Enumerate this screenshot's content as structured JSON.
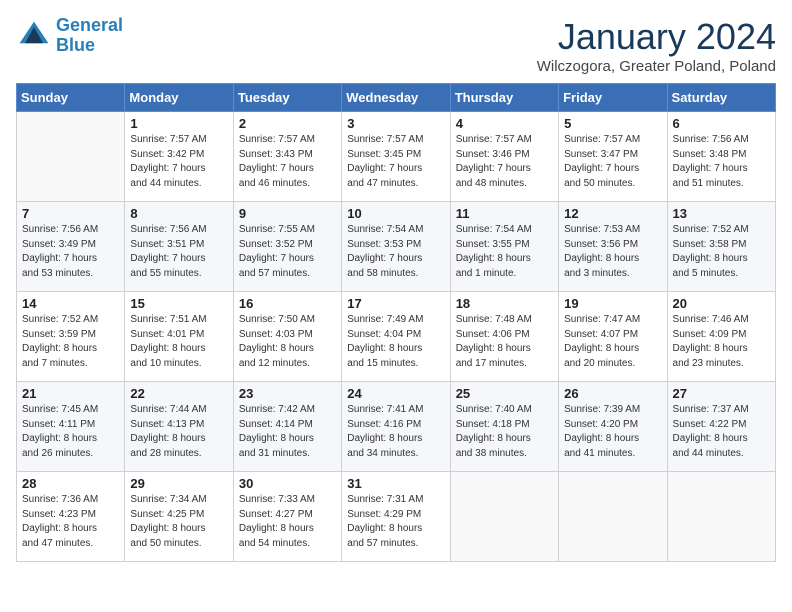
{
  "header": {
    "logo_line1": "General",
    "logo_line2": "Blue",
    "month_title": "January 2024",
    "subtitle": "Wilczogora, Greater Poland, Poland"
  },
  "days_of_week": [
    "Sunday",
    "Monday",
    "Tuesday",
    "Wednesday",
    "Thursday",
    "Friday",
    "Saturday"
  ],
  "weeks": [
    [
      {
        "day": "",
        "info": ""
      },
      {
        "day": "1",
        "info": "Sunrise: 7:57 AM\nSunset: 3:42 PM\nDaylight: 7 hours\nand 44 minutes."
      },
      {
        "day": "2",
        "info": "Sunrise: 7:57 AM\nSunset: 3:43 PM\nDaylight: 7 hours\nand 46 minutes."
      },
      {
        "day": "3",
        "info": "Sunrise: 7:57 AM\nSunset: 3:45 PM\nDaylight: 7 hours\nand 47 minutes."
      },
      {
        "day": "4",
        "info": "Sunrise: 7:57 AM\nSunset: 3:46 PM\nDaylight: 7 hours\nand 48 minutes."
      },
      {
        "day": "5",
        "info": "Sunrise: 7:57 AM\nSunset: 3:47 PM\nDaylight: 7 hours\nand 50 minutes."
      },
      {
        "day": "6",
        "info": "Sunrise: 7:56 AM\nSunset: 3:48 PM\nDaylight: 7 hours\nand 51 minutes."
      }
    ],
    [
      {
        "day": "7",
        "info": "Sunrise: 7:56 AM\nSunset: 3:49 PM\nDaylight: 7 hours\nand 53 minutes."
      },
      {
        "day": "8",
        "info": "Sunrise: 7:56 AM\nSunset: 3:51 PM\nDaylight: 7 hours\nand 55 minutes."
      },
      {
        "day": "9",
        "info": "Sunrise: 7:55 AM\nSunset: 3:52 PM\nDaylight: 7 hours\nand 57 minutes."
      },
      {
        "day": "10",
        "info": "Sunrise: 7:54 AM\nSunset: 3:53 PM\nDaylight: 7 hours\nand 58 minutes."
      },
      {
        "day": "11",
        "info": "Sunrise: 7:54 AM\nSunset: 3:55 PM\nDaylight: 8 hours\nand 1 minute."
      },
      {
        "day": "12",
        "info": "Sunrise: 7:53 AM\nSunset: 3:56 PM\nDaylight: 8 hours\nand 3 minutes."
      },
      {
        "day": "13",
        "info": "Sunrise: 7:52 AM\nSunset: 3:58 PM\nDaylight: 8 hours\nand 5 minutes."
      }
    ],
    [
      {
        "day": "14",
        "info": "Sunrise: 7:52 AM\nSunset: 3:59 PM\nDaylight: 8 hours\nand 7 minutes."
      },
      {
        "day": "15",
        "info": "Sunrise: 7:51 AM\nSunset: 4:01 PM\nDaylight: 8 hours\nand 10 minutes."
      },
      {
        "day": "16",
        "info": "Sunrise: 7:50 AM\nSunset: 4:03 PM\nDaylight: 8 hours\nand 12 minutes."
      },
      {
        "day": "17",
        "info": "Sunrise: 7:49 AM\nSunset: 4:04 PM\nDaylight: 8 hours\nand 15 minutes."
      },
      {
        "day": "18",
        "info": "Sunrise: 7:48 AM\nSunset: 4:06 PM\nDaylight: 8 hours\nand 17 minutes."
      },
      {
        "day": "19",
        "info": "Sunrise: 7:47 AM\nSunset: 4:07 PM\nDaylight: 8 hours\nand 20 minutes."
      },
      {
        "day": "20",
        "info": "Sunrise: 7:46 AM\nSunset: 4:09 PM\nDaylight: 8 hours\nand 23 minutes."
      }
    ],
    [
      {
        "day": "21",
        "info": "Sunrise: 7:45 AM\nSunset: 4:11 PM\nDaylight: 8 hours\nand 26 minutes."
      },
      {
        "day": "22",
        "info": "Sunrise: 7:44 AM\nSunset: 4:13 PM\nDaylight: 8 hours\nand 28 minutes."
      },
      {
        "day": "23",
        "info": "Sunrise: 7:42 AM\nSunset: 4:14 PM\nDaylight: 8 hours\nand 31 minutes."
      },
      {
        "day": "24",
        "info": "Sunrise: 7:41 AM\nSunset: 4:16 PM\nDaylight: 8 hours\nand 34 minutes."
      },
      {
        "day": "25",
        "info": "Sunrise: 7:40 AM\nSunset: 4:18 PM\nDaylight: 8 hours\nand 38 minutes."
      },
      {
        "day": "26",
        "info": "Sunrise: 7:39 AM\nSunset: 4:20 PM\nDaylight: 8 hours\nand 41 minutes."
      },
      {
        "day": "27",
        "info": "Sunrise: 7:37 AM\nSunset: 4:22 PM\nDaylight: 8 hours\nand 44 minutes."
      }
    ],
    [
      {
        "day": "28",
        "info": "Sunrise: 7:36 AM\nSunset: 4:23 PM\nDaylight: 8 hours\nand 47 minutes."
      },
      {
        "day": "29",
        "info": "Sunrise: 7:34 AM\nSunset: 4:25 PM\nDaylight: 8 hours\nand 50 minutes."
      },
      {
        "day": "30",
        "info": "Sunrise: 7:33 AM\nSunset: 4:27 PM\nDaylight: 8 hours\nand 54 minutes."
      },
      {
        "day": "31",
        "info": "Sunrise: 7:31 AM\nSunset: 4:29 PM\nDaylight: 8 hours\nand 57 minutes."
      },
      {
        "day": "",
        "info": ""
      },
      {
        "day": "",
        "info": ""
      },
      {
        "day": "",
        "info": ""
      }
    ]
  ]
}
